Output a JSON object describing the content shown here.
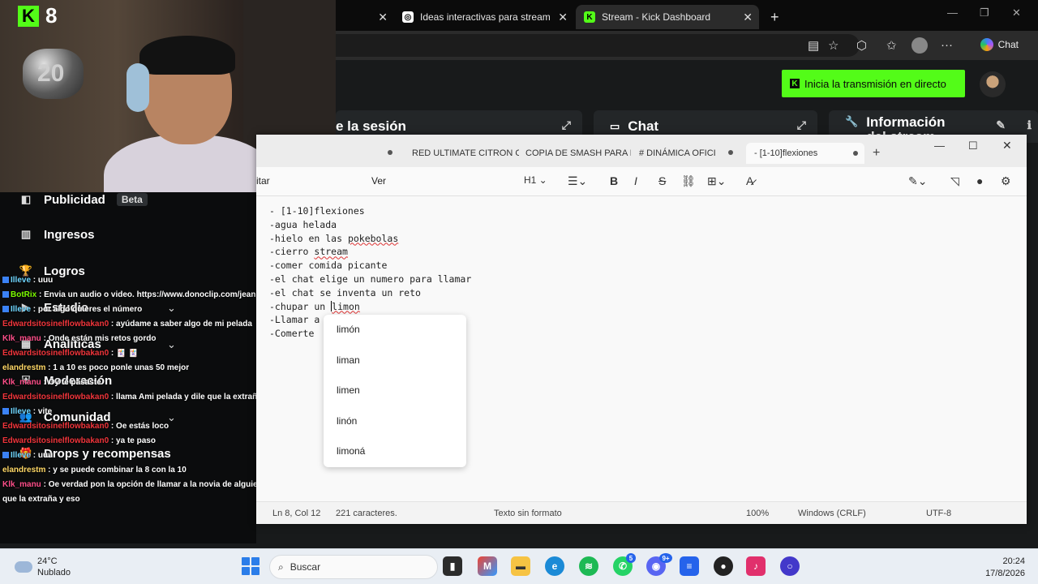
{
  "browser": {
    "tabs": [
      {
        "label": "Ideas interactivas para stream",
        "icon": "chatgpt-icon"
      },
      {
        "label": "Stream - Kick Dashboard",
        "icon": "kick-icon"
      }
    ],
    "chat_button": "Chat",
    "new_tab": "+",
    "close": "✕"
  },
  "kick": {
    "live_button": "Inicia la transmisión en directo",
    "panels": {
      "session": "e la sesión",
      "chat": "Chat",
      "stream_info": "Información del stream"
    },
    "nav": [
      {
        "label": "Publicidad",
        "badge": "Beta",
        "icon": "megaphone-icon"
      },
      {
        "label": "Ingresos",
        "icon": "chart-icon"
      },
      {
        "label": "Logros",
        "icon": "trophy-icon"
      },
      {
        "label": "Estudio",
        "icon": "video-icon"
      },
      {
        "label": "Analíticas",
        "icon": "analytics-icon"
      },
      {
        "label": "Moderación",
        "icon": "shield-icon"
      },
      {
        "label": "Comunidad",
        "icon": "people-icon"
      },
      {
        "label": "Drops y recompensas",
        "icon": "gift-icon"
      }
    ]
  },
  "overlay": {
    "kick_count": "8",
    "balloon_text": "20"
  },
  "chat": [
    {
      "user": "Illeve",
      "msg": "uuu",
      "color": "u-blue",
      "badge": true
    },
    {
      "user": "BotRix",
      "msg": "Envia un audio o video. https://www.donoclip.com/jeanpoolrod",
      "color": "u-green",
      "badge": true
    },
    {
      "user": "Illeve",
      "msg": "por algo quieres el número",
      "color": "u-blue",
      "badge": true
    },
    {
      "user": "Edwardsitosinelflowbakan0",
      "msg": "ayúdame a saber algo de mi pelada",
      "color": "u-red",
      "badge": false
    },
    {
      "user": "Klk_manu",
      "msg": "Onde están mis retos gordo",
      "color": "u-pink",
      "badge": false
    },
    {
      "user": "Edwardsitosinelflowbakan0",
      "msg": "🃏 🃏",
      "color": "u-red",
      "badge": false
    },
    {
      "user": "elandrestm",
      "msg": "1 a 10 es poco ponle unas 50 mejor",
      "color": "u-gold",
      "badge": false
    },
    {
      "user": "Klk_manu",
      "msg": "Oy te pasaste",
      "color": "u-pink",
      "badge": false
    },
    {
      "user": "Edwardsitosinelflowbakan0",
      "msg": "llama Ami pelada y dile que la extraño chupito bts",
      "color": "u-red",
      "badge": false
    },
    {
      "user": "Illeve",
      "msg": "vite",
      "color": "u-blue",
      "badge": true
    },
    {
      "user": "Edwardsitosinelflowbakan0",
      "msg": "Oe estás loco",
      "color": "u-red",
      "badge": false
    },
    {
      "user": "Edwardsitosinelflowbakan0",
      "msg": "ya te paso",
      "color": "u-red",
      "badge": false
    },
    {
      "user": "Illeve",
      "msg": "uuu",
      "color": "u-blue",
      "badge": true
    },
    {
      "user": "elandrestm",
      "msg": "y se puede combinar la 8 con la 10",
      "color": "u-gold",
      "badge": false
    },
    {
      "user": "Klk_manu",
      "msg": "Oe verdad pon la opción de llamar a la novia de alguien o la ex y decir",
      "color": "u-pink",
      "badge": false
    },
    {
      "user": "",
      "msg": "que la extraña y eso",
      "color": "u-pink",
      "badge": false
    }
  ],
  "notepad": {
    "tabs": [
      "RED ULTIMATE CITRON O",
      "COPIA DE SMASH PARA N",
      "# DINÁMICA OFICI",
      "- [1-10]flexiones"
    ],
    "menu": [
      "itar",
      "Ver"
    ],
    "heading": "H1",
    "lines": [
      "- [1-10]flexiones",
      "-agua helada",
      "-hielo en las pokebolas",
      "-cierro stream",
      "-comer comida picante",
      "-el chat elige un numero para llamar",
      "-el chat se inventa un reto",
      "-chupar un limon",
      "-Llamar a",
      "-Comerte"
    ],
    "suggestions": [
      "limón",
      "liman",
      "limen",
      "linón",
      "limoná"
    ],
    "status": {
      "position": "Ln 8, Col 12",
      "chars": "221 caracteres.",
      "format": "Texto sin formato",
      "zoom": "100%",
      "eol": "Windows (CRLF)",
      "encoding": "UTF-8"
    }
  },
  "taskbar": {
    "temp": "24°C",
    "weather": "Nublado",
    "search_placeholder": "Buscar",
    "time": "20:24",
    "date": "17/8/2026",
    "badges": {
      "whatsapp": "5",
      "discord": "9+"
    }
  }
}
